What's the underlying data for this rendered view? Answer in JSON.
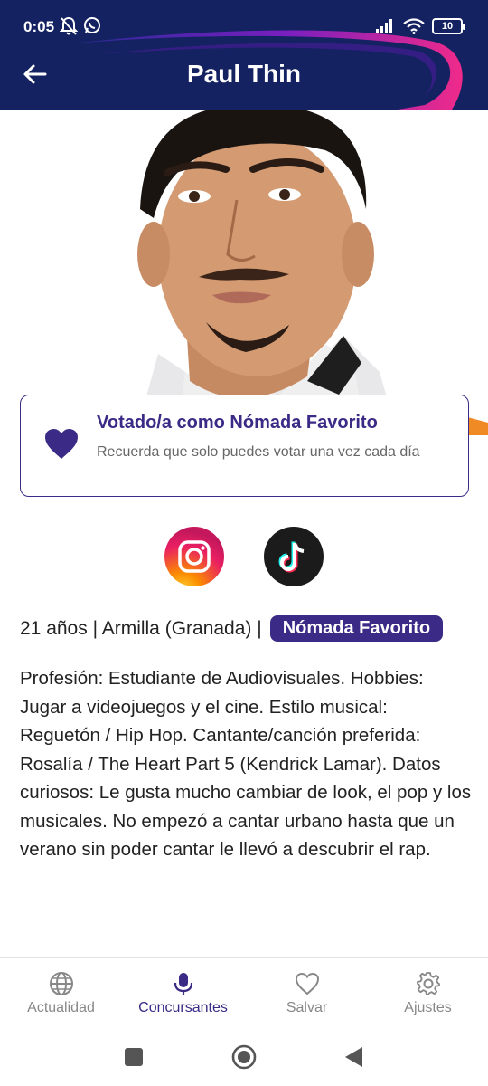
{
  "status_bar": {
    "time": "0:05",
    "battery": "10"
  },
  "header": {
    "title": "Paul Thin"
  },
  "vote_card": {
    "title": "Votado/a como Nómada Favorito",
    "subtitle": "Recuerda que solo puedes votar una vez cada día"
  },
  "info": {
    "details": "21 años | Armilla (Granada) |",
    "badge": "Nómada Favorito"
  },
  "bio": "Profesión: Estudiante de Audiovisuales. Hobbies: Jugar a videojuegos y el cine. Estilo musical: Reguetón / Hip Hop. Cantante/canción preferida: Rosalía / The Heart Part 5 (Kendrick Lamar). Datos curiosos: Le gusta mucho cambiar de look, el pop y los musicales. No empezó a cantar urbano hasta que un verano sin poder cantar le llevó a descubrir el rap.",
  "bottom_nav": [
    {
      "label": "Actualidad",
      "icon": "globe-icon",
      "active": false
    },
    {
      "label": "Concursantes",
      "icon": "microphone-icon",
      "active": true
    },
    {
      "label": "Salvar",
      "icon": "heart-outline-icon",
      "active": false
    },
    {
      "label": "Ajustes",
      "icon": "gear-icon",
      "active": false
    }
  ],
  "colors": {
    "accent": "#3b2a86",
    "header_bg": "#152262",
    "header_swoosh": "#e0207a"
  }
}
